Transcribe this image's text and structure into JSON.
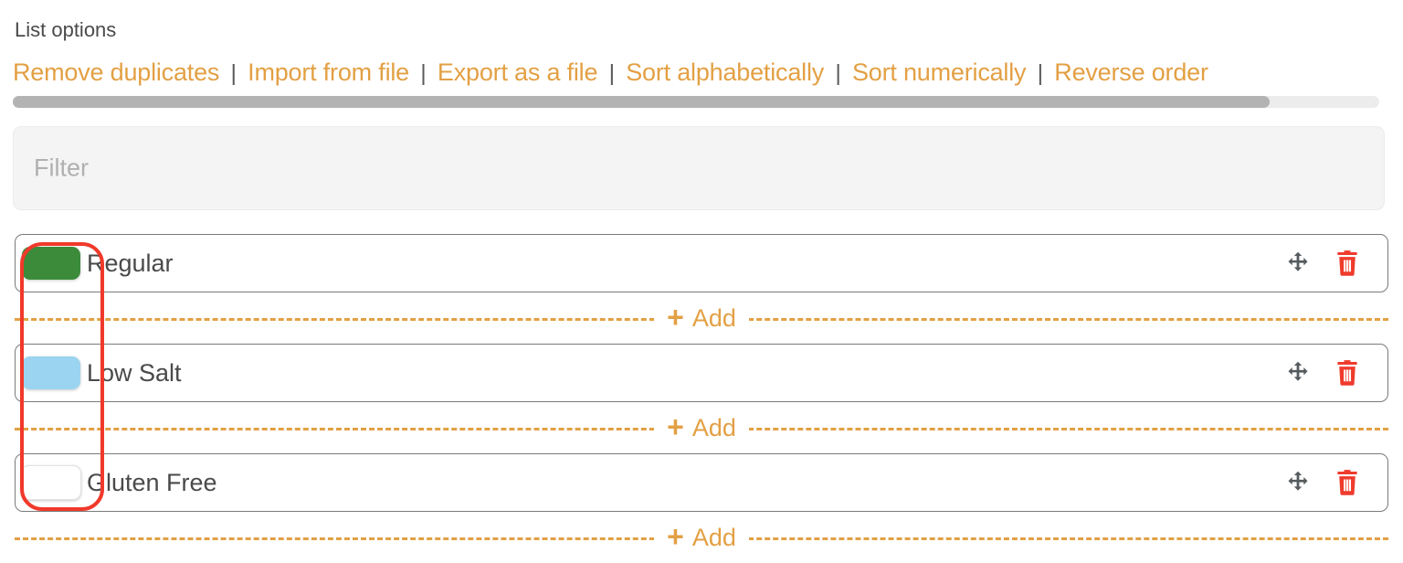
{
  "header": {
    "title": "List options",
    "links": [
      "Remove duplicates",
      "Import from file",
      "Export as a file",
      "Sort alphabetically",
      "Sort numerically",
      "Reverse order"
    ],
    "separator": "|"
  },
  "scrollbar": {
    "orientation": "horizontal",
    "thumb_fraction_percent": 92
  },
  "filter": {
    "placeholder": "Filter",
    "value": ""
  },
  "list": {
    "rows": [
      {
        "label": "Regular",
        "swatch_color": "#3b8b3b",
        "move_icon": "move-arrows-icon",
        "delete_icon": "trash-icon"
      },
      {
        "label": "Low Salt",
        "swatch_color": "#9bd4f0",
        "move_icon": "move-arrows-icon",
        "delete_icon": "trash-icon"
      },
      {
        "label": "Gluten Free",
        "swatch_color": "",
        "move_icon": "move-arrows-icon",
        "delete_icon": "trash-icon"
      }
    ],
    "add_label": "Add",
    "add_plus": "+"
  },
  "colors": {
    "accent_orange": "#e3a044",
    "text_dark": "#4a4a4a",
    "delete_red": "#ef3b2c",
    "annotation_red": "#f0392b",
    "row_border": "#7a7a7a"
  }
}
